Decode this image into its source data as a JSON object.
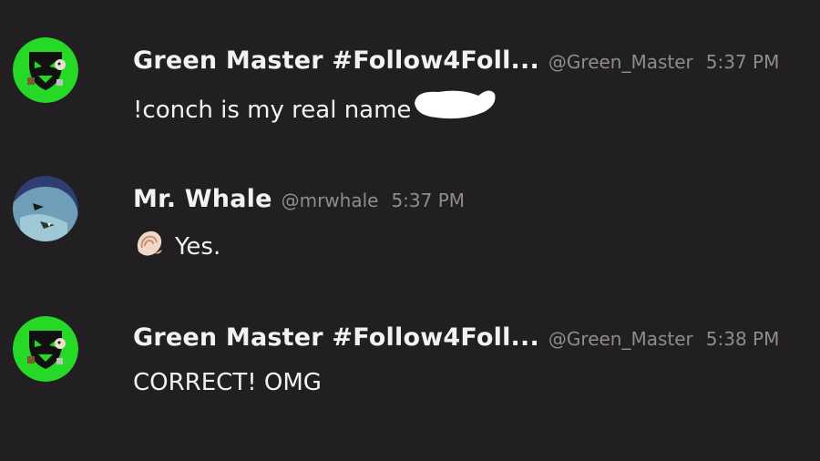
{
  "messages": [
    {
      "author": "Green Master #Follow4Foll...",
      "handle": "@Green_Master",
      "time": "5:37 PM",
      "text": "!conch is my real name",
      "avatar_icon": "green-master-avatar-icon"
    },
    {
      "author": "Mr. Whale",
      "handle": "@mrwhale",
      "time": "5:37 PM",
      "text": "Yes.",
      "avatar_icon": "mr-whale-avatar-icon",
      "emoji_icon": "conch-shell-icon"
    },
    {
      "author": "Green Master #Follow4Foll...",
      "handle": "@Green_Master",
      "time": "5:38 PM",
      "text": "CORRECT! OMG",
      "avatar_icon": "green-master-avatar-icon"
    }
  ],
  "colors": {
    "background": "#221f22",
    "name_text": "#f2f2f2",
    "meta_text": "#8f8c8f",
    "green_avatar": "#27d927"
  }
}
